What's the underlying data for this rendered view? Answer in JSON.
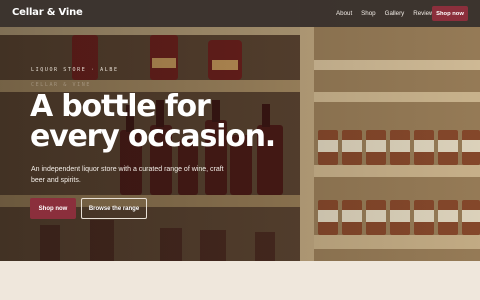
{
  "brand": {
    "name": "Cellar & Vine"
  },
  "nav": {
    "links": [
      "About",
      "Shop",
      "Gallery",
      "Reviews"
    ],
    "cta": "Shop now"
  },
  "hero": {
    "eyebrow": "LIQUOR STORE · ALBE",
    "eyebrow_faded": "CELLAR & VINE",
    "headline": "A bottle for every occasion.",
    "subtitle": "An independent liquor store with a curated range of wine, craft beer and spirits.",
    "primary_button": "Shop now",
    "secondary_button": "Browse the range"
  },
  "colors": {
    "accent": "#8b2f3c",
    "nav_bg": "#3c3430",
    "page_bg": "#efe7dc"
  }
}
